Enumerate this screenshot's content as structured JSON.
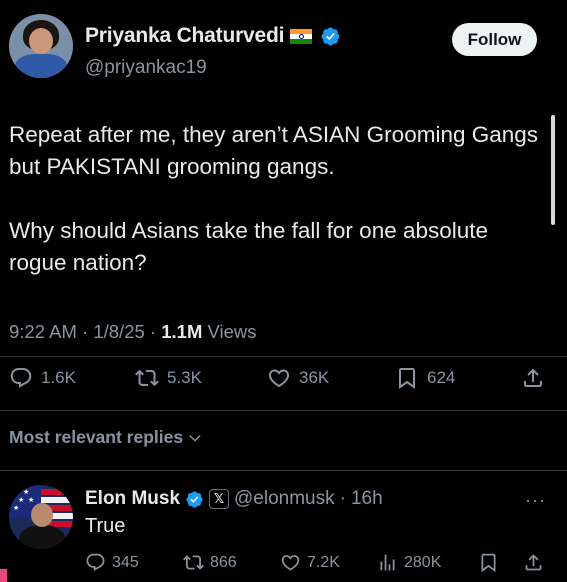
{
  "author": {
    "name": "Priyanka Chaturvedi",
    "handle": "@priyankac19",
    "flag_icon": "india-flag-icon",
    "verified_icon": "verified-badge-icon"
  },
  "follow_button": {
    "label": "Follow"
  },
  "tweet": {
    "paragraphs": [
      "Repeat after me, they aren’t ASIAN Grooming Gangs but PAKISTANI grooming gangs.",
      "Why should Asians take the fall for one absolute rogue nation?"
    ],
    "time": "9:22 AM",
    "date": "1/8/25",
    "views_count": "1.1M",
    "views_label": "Views",
    "separator": "·"
  },
  "actions": {
    "replies": "1.6K",
    "reposts": "5.3K",
    "likes": "36K",
    "bookmarks": "624"
  },
  "replies_filter": {
    "label": "Most relevant replies"
  },
  "reply": {
    "name": "Elon Musk",
    "handle": "@elonmusk",
    "time": "16h",
    "text": "True",
    "more_label": "···",
    "actions": {
      "replies": "345",
      "reposts": "866",
      "likes": "7.2K",
      "views": "280K"
    }
  },
  "colors": {
    "background": "#000000",
    "text": "#e7e9ea",
    "muted": "#8b949e",
    "verified": "#1d9bf0",
    "follow_bg": "#eff3f4"
  }
}
